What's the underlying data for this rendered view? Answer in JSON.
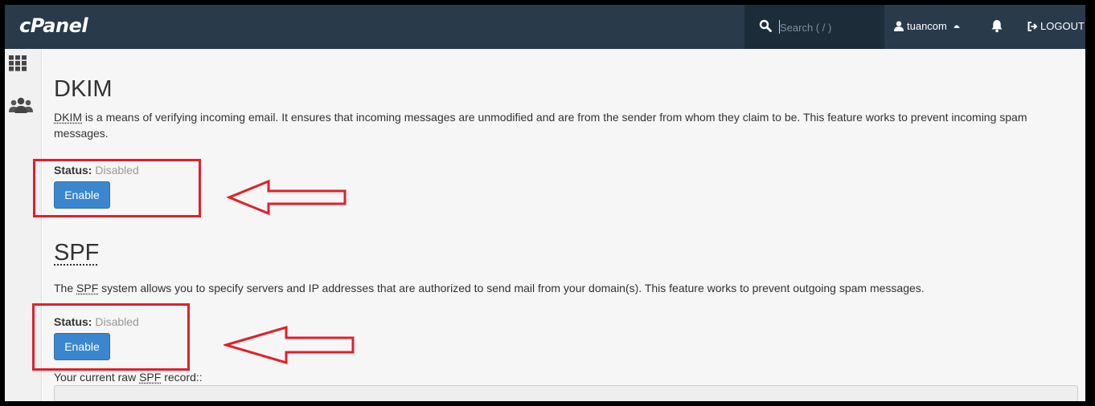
{
  "header": {
    "logo": "cPanel",
    "search_placeholder": "Search ( / )",
    "username": "tuancom",
    "logout_label": "LOGOUT"
  },
  "dkim": {
    "title": "DKIM",
    "desc_abbr": "DKIM",
    "desc_rest": " is a means of verifying incoming email. It ensures that incoming messages are unmodified and are from the sender from whom they claim to be. This feature works to prevent incoming spam messages.",
    "status_label": "Status:",
    "status_value": "Disabled",
    "button_label": "Enable"
  },
  "spf": {
    "title": "SPF",
    "desc_prefix": "The ",
    "desc_abbr": "SPF",
    "desc_rest": " system allows you to specify servers and IP addresses that are authorized to send mail from your domain(s). This feature works to prevent outgoing spam messages.",
    "status_label": "Status:",
    "status_value": "Disabled",
    "button_label": "Enable",
    "raw_label_prefix": "Your current raw ",
    "raw_label_abbr": "SPF",
    "raw_label_suffix": " record::",
    "raw_value": ""
  },
  "colors": {
    "topbar": "#293a4a",
    "button": "#3a87cf",
    "annotation": "#e0202a"
  }
}
